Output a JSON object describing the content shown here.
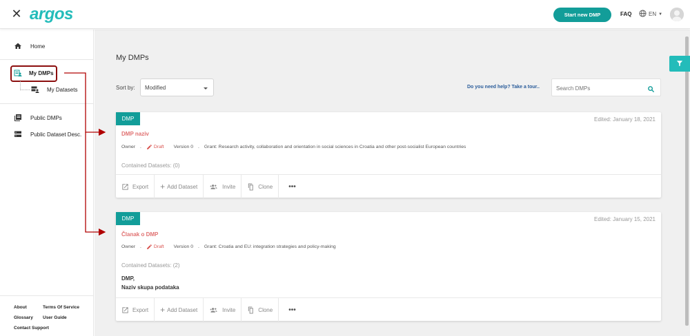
{
  "header": {
    "logo_text": "argos",
    "start_button": "Start new DMP",
    "faq": "FAQ",
    "language": "EN"
  },
  "sidebar": {
    "items": [
      {
        "label": "Home",
        "icon": "home-icon"
      },
      {
        "label": "My DMPs",
        "icon": "my-dmps-icon"
      },
      {
        "label": "My Datasets",
        "icon": "my-datasets-icon"
      },
      {
        "label": "Public DMPs",
        "icon": "public-dmps-icon"
      },
      {
        "label": "Public Dataset Desc.",
        "icon": "public-dataset-icon"
      }
    ],
    "footer": {
      "about": "About",
      "terms": "Terms Of Service",
      "glossary": "Glossary",
      "user_guide": "User Guide",
      "contact": "Contact Support"
    }
  },
  "main": {
    "title": "My DMPs",
    "sort_label": "Sort by:",
    "sort_value": "Modified",
    "help_text": "Do you need help? Take a tour..",
    "search_placeholder": "Search DMPs"
  },
  "cards": [
    {
      "tag": "DMP",
      "edited": "Edited: January 18, 2021",
      "title": "DMP naziv",
      "owner": "Owner",
      "status": "Draft",
      "version": "Version 0",
      "grant": "Grant: Research activity, collaboration and orientation in social sciences in Croatia and other post-socialist European countries",
      "contained": "Contained Datasets: (0)",
      "datasets": []
    },
    {
      "tag": "DMP",
      "edited": "Edited: January 15, 2021",
      "title": "Članak o DMP",
      "owner": "Owner",
      "status": "Draft",
      "version": "Version 0",
      "grant": "Grant: Croatia and EU: integration strategies and policy-making",
      "contained": "Contained Datasets: (2)",
      "datasets": [
        "DMP,",
        "Naziv skupa podataka"
      ]
    }
  ],
  "actions": {
    "export": "Export",
    "add_dataset": "Add Dataset",
    "invite": "Invite",
    "clone": "Clone",
    "more": "•••"
  },
  "colors": {
    "brand": "#23bcba",
    "brand_dark": "#129d99",
    "title_red": "#e07070",
    "annotation": "#b00000"
  }
}
